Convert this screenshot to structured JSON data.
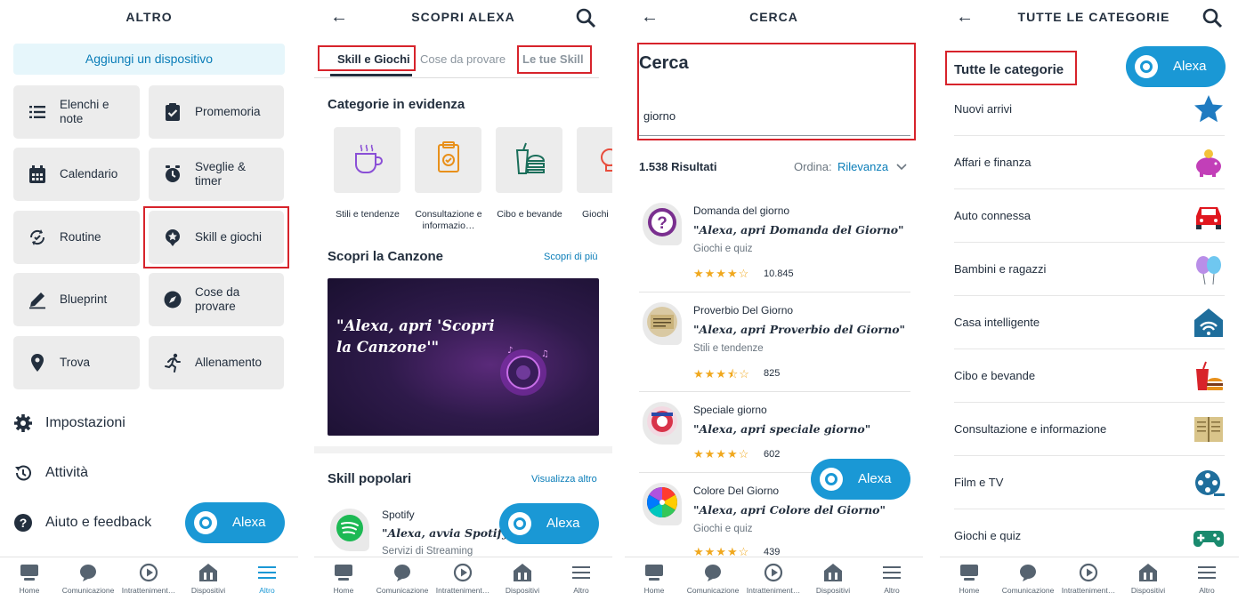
{
  "panel1": {
    "title": "ALTRO",
    "add_device": "Aggiungi un dispositivo",
    "tiles": [
      {
        "label": "Elenchi e note",
        "icon": "list-icon"
      },
      {
        "label": "Promemoria",
        "icon": "clipboard-check-icon"
      },
      {
        "label": "Calendario",
        "icon": "calendar-icon"
      },
      {
        "label": "Sveglie & timer",
        "icon": "alarm-clock-icon"
      },
      {
        "label": "Routine",
        "icon": "routine-icon"
      },
      {
        "label": "Skill e giochi",
        "icon": "skill-icon"
      },
      {
        "label": "Blueprint",
        "icon": "pencil-icon"
      },
      {
        "label": "Cose da provare",
        "icon": "compass-icon"
      },
      {
        "label": "Trova",
        "icon": "location-pin-icon"
      },
      {
        "label": "Allenamento",
        "icon": "running-icon"
      }
    ],
    "list": [
      {
        "label": "Impostazioni",
        "icon": "gear-icon"
      },
      {
        "label": "Attività",
        "icon": "history-icon"
      },
      {
        "label": "Aiuto e feedback",
        "icon": "help-icon"
      }
    ]
  },
  "panel2": {
    "title": "SCOPRI ALEXA",
    "tabs": [
      "Skill e Giochi",
      "Cose da provare",
      "Le tue Skill"
    ],
    "featured_heading": "Categorie in evidenza",
    "categories": [
      "Stili e tendenze",
      "Consultazione e informazio…",
      "Cibo e bevande",
      "Giochi"
    ],
    "song_heading": "Scopri la Canzone",
    "song_link": "Scopri di più",
    "banner_text": "\"Alexa, apri 'Scopri la Canzone'\"",
    "popular_heading": "Skill popolari",
    "popular_link": "Visualizza altro",
    "popular_skill": {
      "name": "Spotify",
      "invocation": "\"Alexa, avvia Spotify",
      "category": "Servizi di Streaming"
    }
  },
  "panel3": {
    "title": "CERCA",
    "search_heading": "Cerca",
    "search_value": "giorno",
    "results_count": "1.538 Risultati",
    "sort_label": "Ordina:",
    "sort_value": "Rilevanza",
    "results": [
      {
        "name": "Domanda del giorno",
        "invocation": "\"Alexa, apri Domanda del Giorno\"",
        "category": "Giochi e quiz",
        "rating": 4,
        "count": "10.845"
      },
      {
        "name": "Proverbio Del Giorno",
        "invocation": "\"Alexa, apri Proverbio del Giorno\"",
        "category": "Stili e tendenze",
        "rating": 3.5,
        "count": "825"
      },
      {
        "name": "Speciale giorno",
        "invocation": "\"Alexa, apri speciale giorno\"",
        "category": "",
        "rating": 4,
        "count": "602"
      },
      {
        "name": "Colore Del Giorno",
        "invocation": "\"Alexa, apri Colore del Giorno\"",
        "category": "Giochi e quiz",
        "rating": 4,
        "count": "439"
      }
    ]
  },
  "panel4": {
    "title": "TUTTE LE CATEGORIE",
    "heading": "Tutte le categorie",
    "categories": [
      {
        "label": "Nuovi arrivi",
        "icon": "star-icon"
      },
      {
        "label": "Affari e finanza",
        "icon": "piggy-bank-icon"
      },
      {
        "label": "Auto connessa",
        "icon": "car-icon"
      },
      {
        "label": "Bambini e ragazzi",
        "icon": "balloons-icon"
      },
      {
        "label": "Casa intelligente",
        "icon": "smart-home-icon"
      },
      {
        "label": "Cibo e bevande",
        "icon": "food-drink-icon"
      },
      {
        "label": "Consultazione e informazione",
        "icon": "book-icon"
      },
      {
        "label": "Film e TV",
        "icon": "film-reel-icon"
      },
      {
        "label": "Giochi e quiz",
        "icon": "gamepad-icon"
      }
    ]
  },
  "alexa_button": "Alexa",
  "nav": [
    "Home",
    "Comunicazione",
    "Intratteniment…",
    "Dispositivi",
    "Altro"
  ],
  "nav_alt": [
    "Home",
    "Comunicazione",
    "Intratteniment…",
    "Dispositivi",
    "Altro"
  ],
  "colors": {
    "accent": "#1a98d5",
    "highlight": "#d7232b",
    "tile_bg": "#ececec",
    "star": "#f0a81e"
  }
}
